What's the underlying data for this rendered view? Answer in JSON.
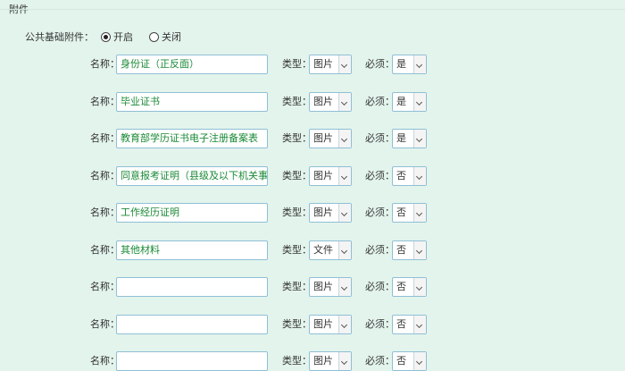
{
  "section": {
    "title": "附件"
  },
  "public_attachment": {
    "label": "公共基础附件：",
    "options": [
      {
        "label": "开启",
        "checked": true
      },
      {
        "label": "关闭",
        "checked": false
      }
    ]
  },
  "field_labels": {
    "name": "名称：",
    "type": "类型：",
    "required": "必须："
  },
  "rows": [
    {
      "name": "身份证（正反面）",
      "type": "图片",
      "required": "是"
    },
    {
      "name": "毕业证书",
      "type": "图片",
      "required": "是"
    },
    {
      "name": "教育部学历证书电子注册备案表",
      "type": "图片",
      "required": "是"
    },
    {
      "name": "同意报考证明（县级及以下机关事业单",
      "type": "图片",
      "required": "否"
    },
    {
      "name": "工作经历证明",
      "type": "图片",
      "required": "否"
    },
    {
      "name": "其他材料",
      "type": "文件",
      "required": "否"
    },
    {
      "name": "",
      "type": "图片",
      "required": "否"
    },
    {
      "name": "",
      "type": "图片",
      "required": "否"
    },
    {
      "name": "",
      "type": "图片",
      "required": "否"
    }
  ]
}
